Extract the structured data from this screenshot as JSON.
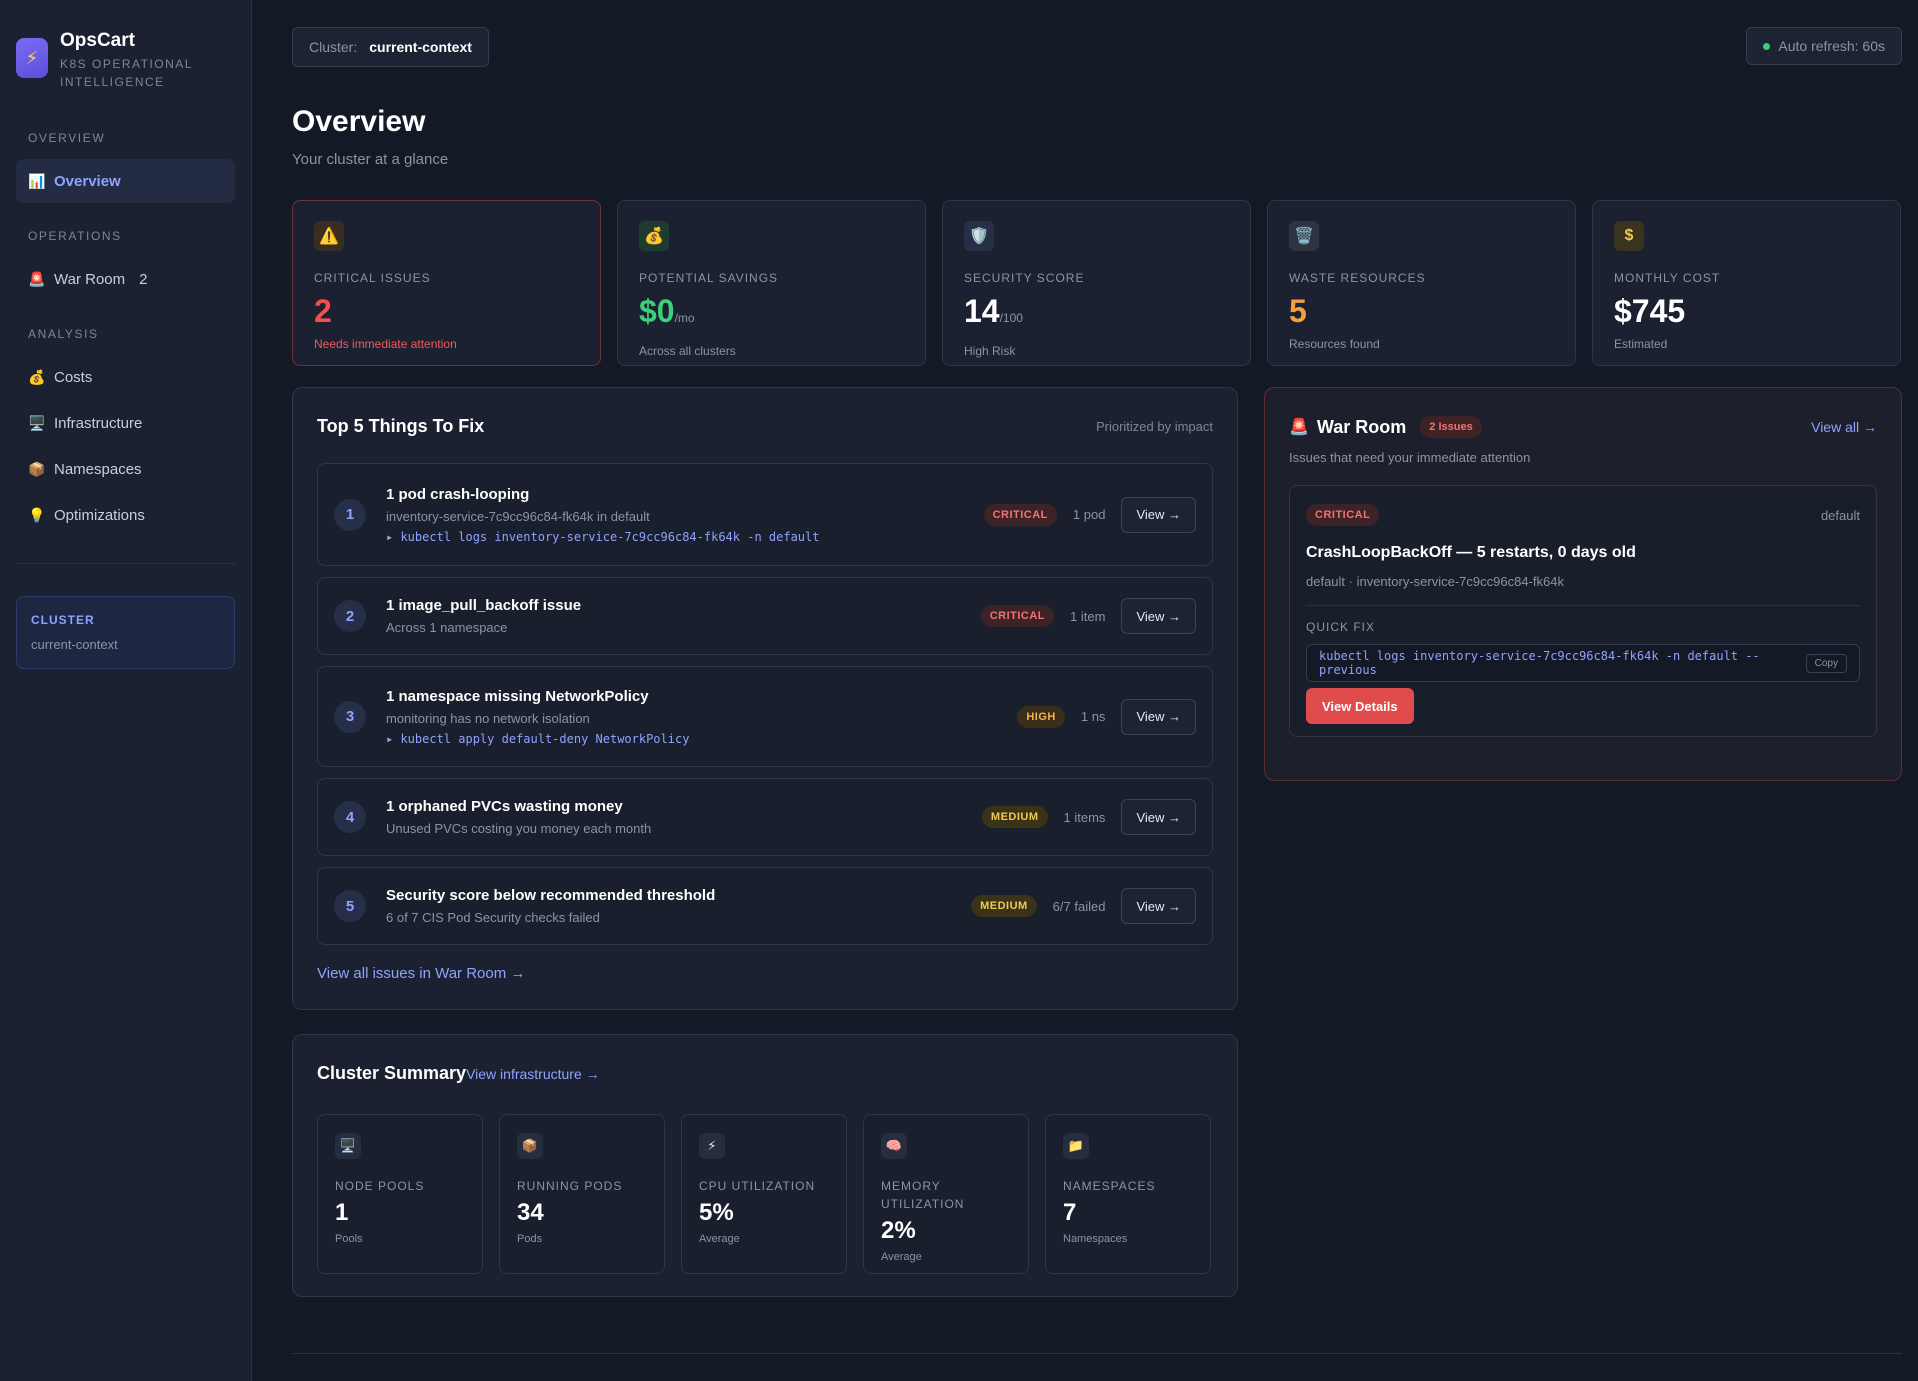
{
  "brand": {
    "name": "OpsCart",
    "subtitle": "K8S OPERATIONAL INTELLIGENCE",
    "icon": "lightning-icon"
  },
  "sidebar": {
    "sections": [
      {
        "label": "OVERVIEW",
        "items": [
          {
            "label": "Overview",
            "icon": "chart-icon",
            "active": true
          }
        ]
      },
      {
        "label": "OPERATIONS",
        "items": [
          {
            "label": "War Room",
            "icon": "siren-icon",
            "count": "2"
          }
        ]
      },
      {
        "label": "ANALYSIS",
        "items": [
          {
            "label": "Costs",
            "icon": "moneybag-icon"
          },
          {
            "label": "Infrastructure",
            "icon": "monitor-icon"
          },
          {
            "label": "Namespaces",
            "icon": "package-icon"
          },
          {
            "label": "Optimizations",
            "icon": "lightbulb-icon"
          }
        ]
      }
    ],
    "cluster": {
      "label": "CLUSTER",
      "value": "current-context"
    }
  },
  "topbar": {
    "cluster_key": "Cluster:",
    "cluster_value": "current-context",
    "refresh": "Auto refresh: 60s"
  },
  "page": {
    "title": "Overview",
    "subtitle": "Your cluster at a glance"
  },
  "stats": [
    {
      "label": "CRITICAL ISSUES",
      "value": "2",
      "unit": "",
      "note": "Needs immediate attention",
      "icon": "warning-icon",
      "color": "#f24e4e"
    },
    {
      "label": "POTENTIAL SAVINGS",
      "value": "$0",
      "unit": "/mo",
      "note": "Across all clusters",
      "icon": "moneybag-icon",
      "color": "#3ecf7a"
    },
    {
      "label": "SECURITY SCORE",
      "value": "14",
      "unit": "/100",
      "note": "High Risk",
      "icon": "shield-icon",
      "color": "#ffffff"
    },
    {
      "label": "WASTE RESOURCES",
      "value": "5",
      "unit": "",
      "note": "Resources found",
      "icon": "trash-icon",
      "color": "#f5a040"
    },
    {
      "label": "MONTHLY COST",
      "value": "$745",
      "unit": "",
      "note": "Estimated",
      "icon": "dollar-icon",
      "color": "#ffffff"
    }
  ],
  "fixes": {
    "title": "Top 5 Things To Fix",
    "subtitle": "Prioritized by impact",
    "items": [
      {
        "num": "1",
        "title": "1 pod crash-looping",
        "desc": "inventory-service-7c9cc96c84-fk64k in default",
        "cmd": "▸ kubectl logs inventory-service-7c9cc96c84-fk64k -n default",
        "badge": "CRITICAL",
        "severity": "critical",
        "count": "1 pod",
        "action": "View →"
      },
      {
        "num": "2",
        "title": "1 image_pull_backoff issue",
        "desc": "Across 1 namespace",
        "cmd": "",
        "badge": "CRITICAL",
        "severity": "critical",
        "count": "1 item",
        "action": "View →"
      },
      {
        "num": "3",
        "title": "1 namespace missing NetworkPolicy",
        "desc": "monitoring has no network isolation",
        "cmd": "▸ kubectl apply default-deny NetworkPolicy",
        "badge": "HIGH",
        "severity": "high",
        "count": "1 ns",
        "action": "View →"
      },
      {
        "num": "4",
        "title": "1 orphaned PVCs wasting money",
        "desc": "Unused PVCs costing you money each month",
        "cmd": "",
        "badge": "MEDIUM",
        "severity": "medium",
        "count": "1 items",
        "action": "View →"
      },
      {
        "num": "5",
        "title": "Security score below recommended threshold",
        "desc": "6 of 7 CIS Pod Security checks failed",
        "cmd": "",
        "badge": "MEDIUM",
        "severity": "medium",
        "count": "6/7 failed",
        "action": "View →"
      }
    ],
    "footer_link": "View all issues in War Room →"
  },
  "war_room": {
    "title": "War Room",
    "badge": "2 Issues",
    "view_all": "View all →",
    "subtitle": "Issues that need your immediate attention",
    "card": {
      "severity": "CRITICAL",
      "namespace": "default",
      "issue": "CrashLoopBackOff — 5 restarts, 0 days old",
      "meta": "default · inventory-service-7c9cc96c84-fk64k",
      "quick_fix_label": "QUICK FIX",
      "command": "kubectl logs inventory-service-7c9cc96c84-fk64k -n default --previous",
      "copy": "Copy",
      "details": "View Details"
    }
  },
  "summary": {
    "title": "Cluster Summary",
    "link": "View infrastructure →",
    "cards": [
      {
        "label": "NODE POOLS",
        "value": "1",
        "note": "Pools",
        "icon": "monitor-icon"
      },
      {
        "label": "RUNNING PODS",
        "value": "34",
        "note": "Pods",
        "icon": "package-icon"
      },
      {
        "label": "CPU UTILIZATION",
        "value": "5%",
        "note": "Average",
        "icon": "lightning-icon"
      },
      {
        "label": "MEMORY UTILIZATION",
        "value": "2%",
        "note": "Average",
        "icon": "brain-icon"
      },
      {
        "label": "NAMESPACES",
        "value": "7",
        "note": "Namespaces",
        "icon": "folder-icon"
      }
    ]
  }
}
